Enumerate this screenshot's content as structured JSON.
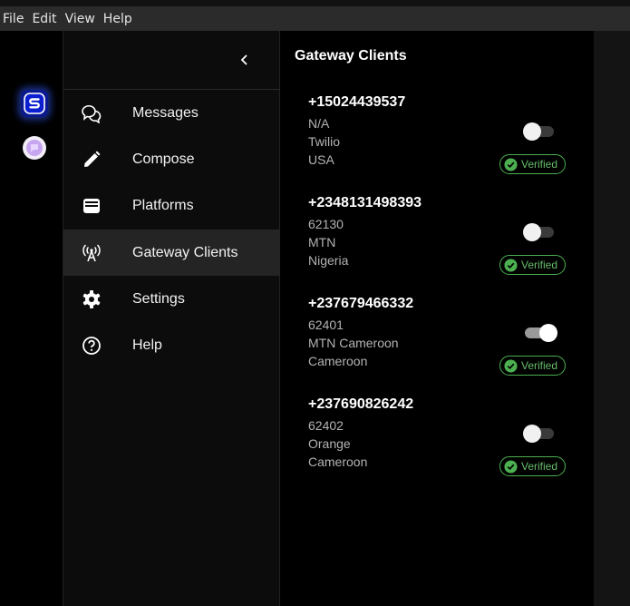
{
  "menubar": {
    "items": [
      "File",
      "Edit",
      "View",
      "Help"
    ]
  },
  "nav": {
    "items": [
      {
        "label": "Messages",
        "icon": "messages-icon"
      },
      {
        "label": "Compose",
        "icon": "pencil-icon"
      },
      {
        "label": "Platforms",
        "icon": "wallet-icon"
      },
      {
        "label": "Gateway Clients",
        "icon": "antenna-icon",
        "selected": true
      },
      {
        "label": "Settings",
        "icon": "gear-icon"
      },
      {
        "label": "Help",
        "icon": "help-icon"
      }
    ]
  },
  "main": {
    "title": "Gateway Clients",
    "clients": [
      {
        "phone": "+15024439537",
        "code": "N/A",
        "operator": "Twilio",
        "country": "USA",
        "enabled": false,
        "status": "Verified"
      },
      {
        "phone": "+2348131498393",
        "code": "62130",
        "operator": "MTN",
        "country": "Nigeria",
        "enabled": false,
        "status": "Verified"
      },
      {
        "phone": "+237679466332",
        "code": "62401",
        "operator": "MTN Cameroon",
        "country": "Cameroon",
        "enabled": true,
        "status": "Verified"
      },
      {
        "phone": "+237690826242",
        "code": "62402",
        "operator": "Orange",
        "country": "Cameroon",
        "enabled": false,
        "status": "Verified"
      }
    ]
  },
  "colors": {
    "accent_blue": "#0a1a8c",
    "verified_green": "#4caf50",
    "selected_bg": "#242424"
  }
}
